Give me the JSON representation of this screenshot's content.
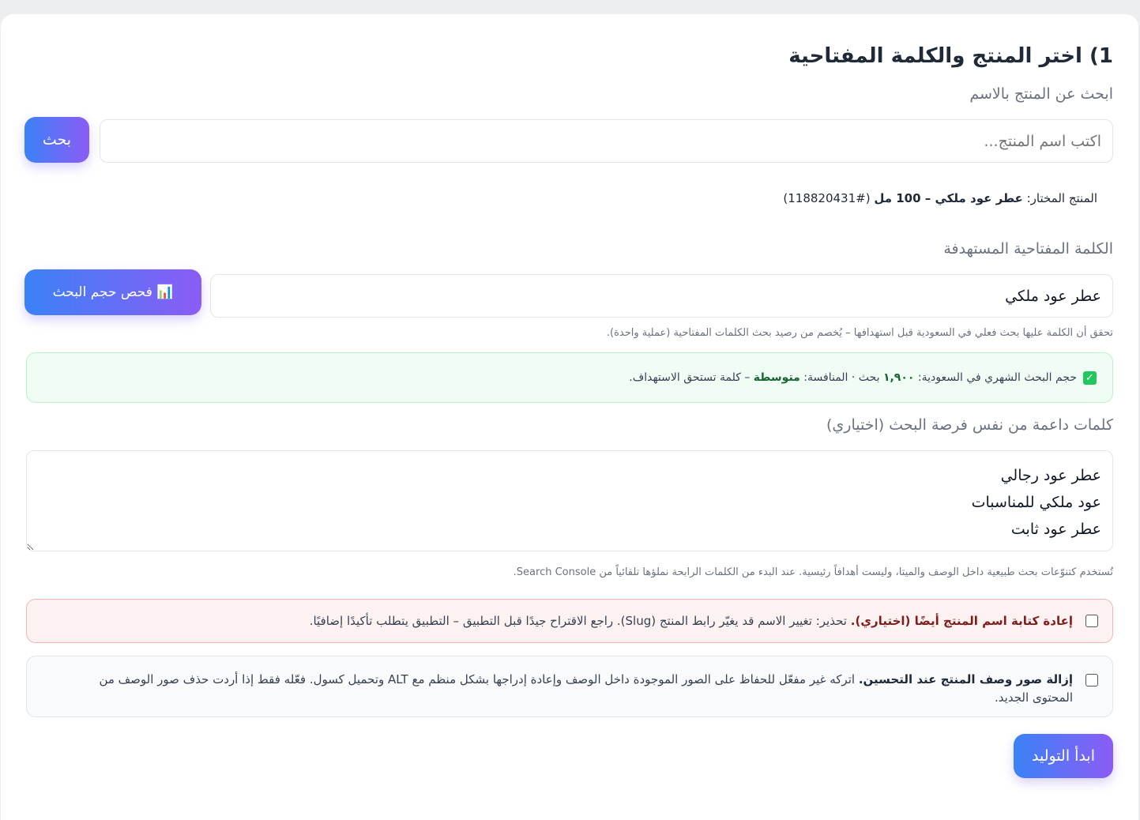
{
  "step": {
    "title": "1) اختر المنتج والكلمة المفتاحية"
  },
  "product_search": {
    "label": "ابحث عن المنتج بالاسم",
    "placeholder": "اكتب اسم المنتج...",
    "button_label": "بحث"
  },
  "selected_product": {
    "prefix": "المنتج المختار:",
    "name": "عطر عود ملكي – 100 مل",
    "id": "(#118820431)"
  },
  "keyword": {
    "label": "الكلمة المفتاحية المستهدفة",
    "value": "عطر عود ملكي",
    "button_label": "📊 فحص حجم البحث",
    "hint": "تحقق أن الكلمة عليها بحث فعلي في السعودية قبل استهدافها – يُخصم من رصيد بحث الكلمات المفتاحية (عملية واحدة)."
  },
  "volume_result": {
    "icon": "check-box-icon",
    "text_before": "حجم البحث الشهري في السعودية:",
    "volume": "١,٩٠٠",
    "text_mid": "بحث · المنافسة:",
    "competition": "متوسطة",
    "text_after": "– كلمة تستحق الاستهداف."
  },
  "supporting_keywords": {
    "label": "كلمات داعمة من نفس فرصة البحث (اختياري)",
    "value": "عطر عود رجالي\nعود ملكي للمناسبات\nعطر عود ثابت",
    "hint": "تُستخدم كتنوّعات بحث طبيعية داخل الوصف والميتا، وليست أهدافاً رئيسية. عند البدء من الكلمات الرابحة نملؤها تلقائياً من Search Console."
  },
  "rewrite_name_option": {
    "checked": false,
    "strong": "إعادة كتابة اسم المنتج أيضًا (اختياري).",
    "text": "تحذير: تغيير الاسم قد يغيّر رابط المنتج (Slug). راجع الاقتراح جيدًا قبل التطبيق – التطبيق يتطلب تأكيدًا إضافيًا."
  },
  "remove_images_option": {
    "checked": false,
    "strong": "إزالة صور وصف المنتج عند التحسين.",
    "text": "اتركه غير مفعّل للحفاظ على الصور الموجودة داخل الوصف وإعادة إدراجها بشكل منظم مع ALT وتحميل كسول. فعّله فقط إذا أردت حذف صور الوصف من المحتوى الجديد."
  },
  "generate_button_label": "ابدأ التوليد",
  "colors": {
    "gradient_start": "#3b82f6",
    "gradient_end": "#8b5cf6",
    "success_bg": "#effdf4",
    "warning_bg": "#fdf2f2"
  }
}
